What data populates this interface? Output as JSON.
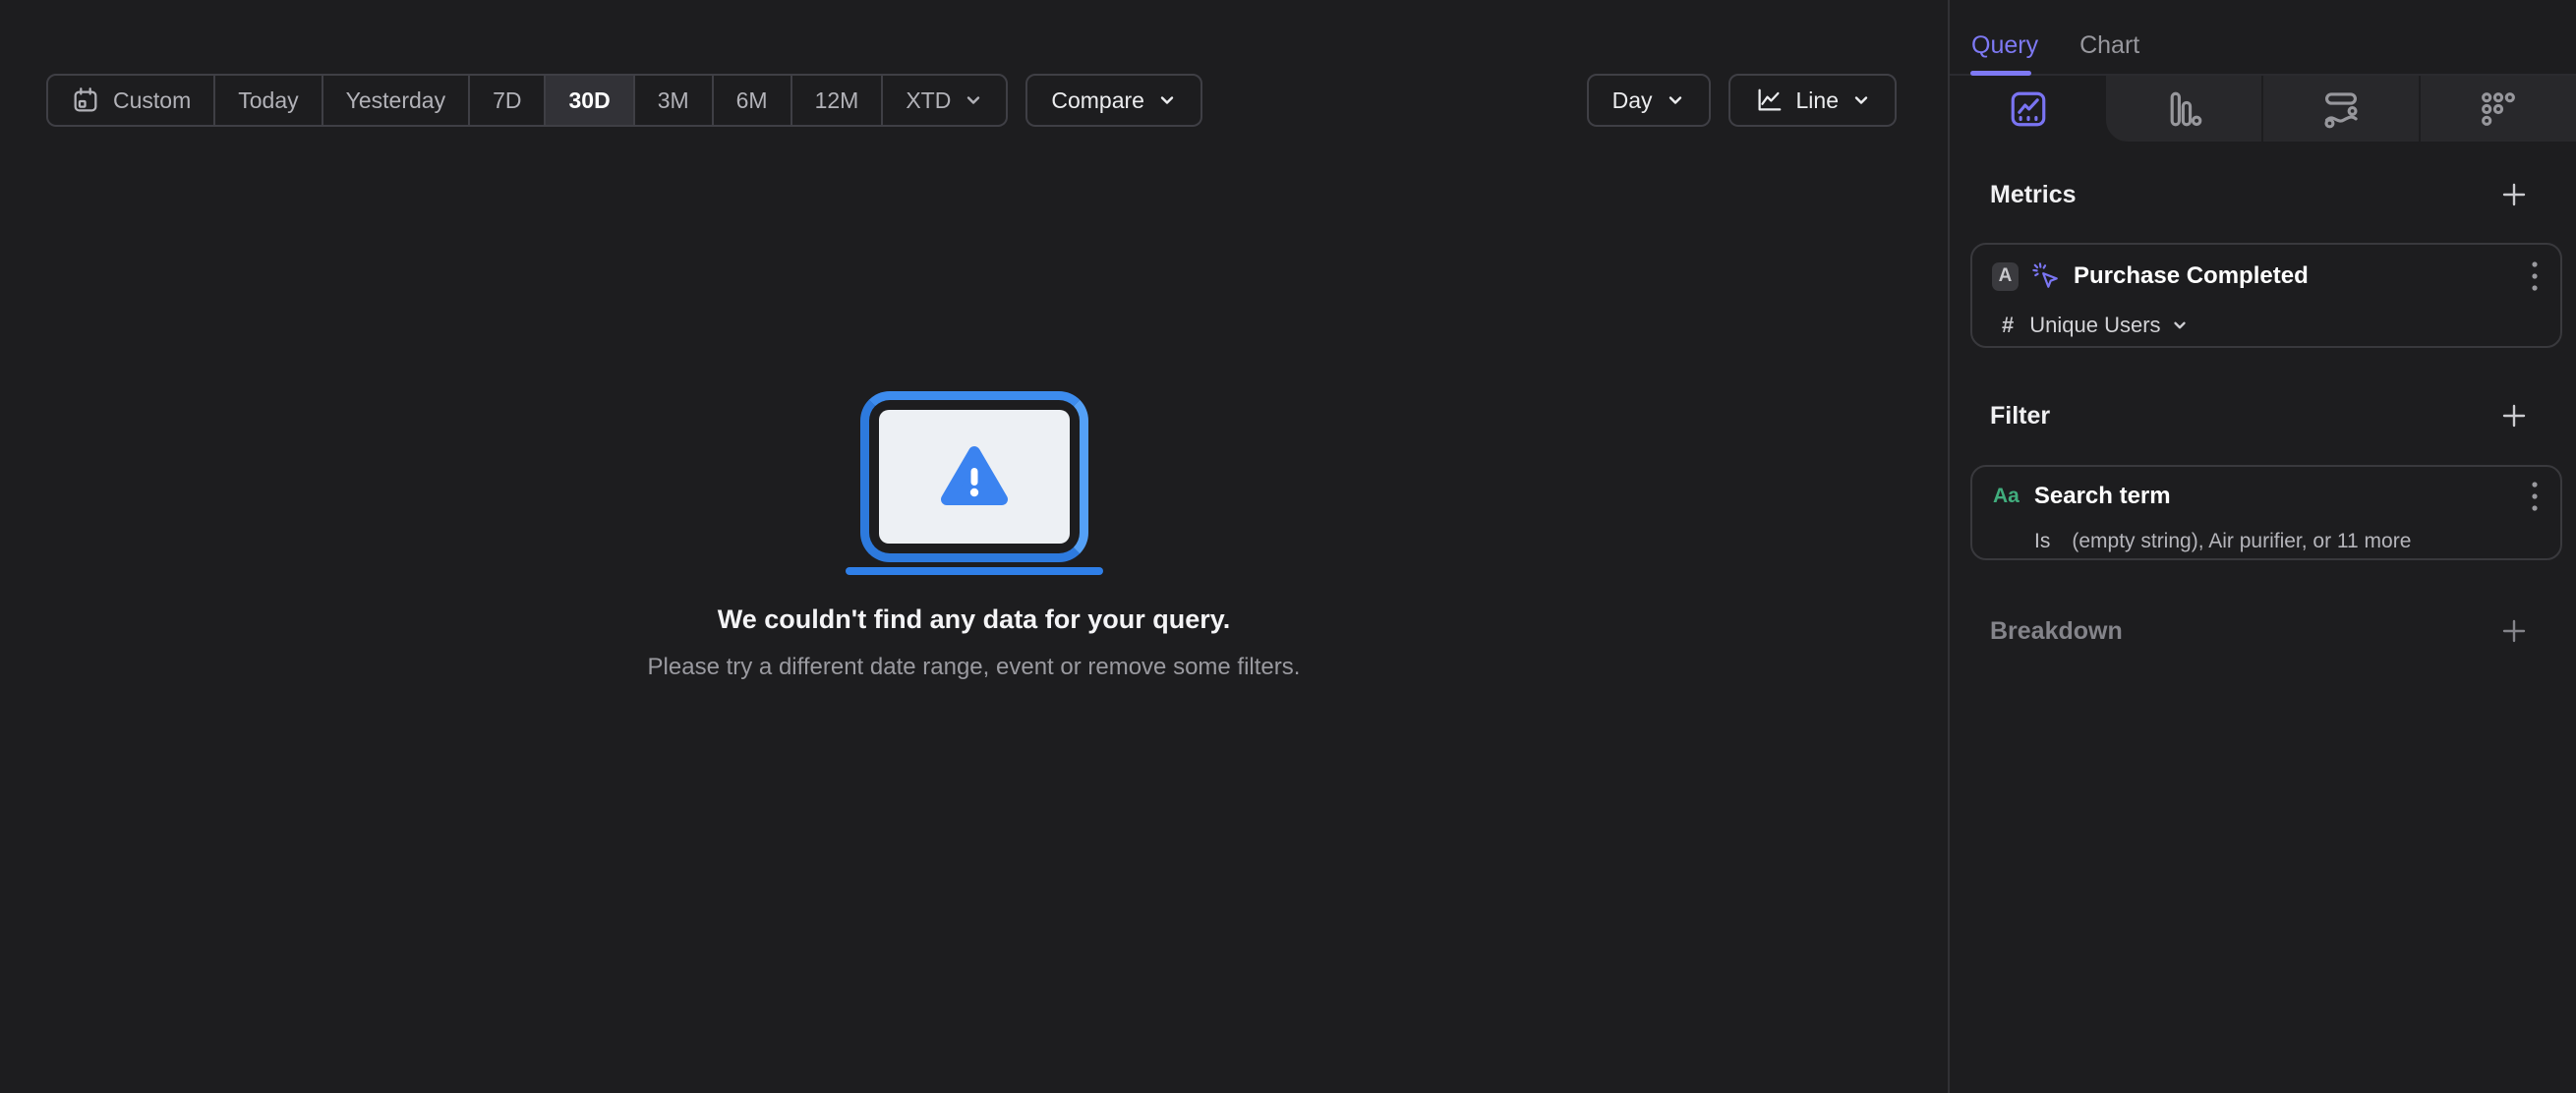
{
  "toolbar": {
    "date_ranges": [
      "Custom",
      "Today",
      "Yesterday",
      "7D",
      "30D",
      "3M",
      "6M",
      "12M",
      "XTD"
    ],
    "selected_range": "30D",
    "compare_label": "Compare",
    "granularity_label": "Day",
    "chart_type_label": "Line"
  },
  "empty_state": {
    "title": "We couldn't find any data for your query.",
    "subtitle": "Please try a different date range, event or remove some filters."
  },
  "sidebar": {
    "tabs": {
      "query": "Query",
      "chart": "Chart"
    },
    "view_tabs": [
      "insights",
      "funnels",
      "flows",
      "retention"
    ],
    "metrics": {
      "heading": "Metrics",
      "items": [
        {
          "letter": "A",
          "name": "Purchase Completed",
          "aggregation_symbol": "#",
          "aggregation": "Unique Users"
        }
      ]
    },
    "filter": {
      "heading": "Filter",
      "items": [
        {
          "type_icon": "Aa",
          "property": "Search term",
          "operator": "Is",
          "value": "(empty string), Air purifier, or 11 more"
        }
      ]
    },
    "breakdown": {
      "heading": "Breakdown"
    }
  },
  "colors": {
    "accent_purple": "#7e79f4",
    "illustration_blue": "#3b82f6",
    "string_green": "#41ad7d",
    "background": "#1d1d1f"
  }
}
